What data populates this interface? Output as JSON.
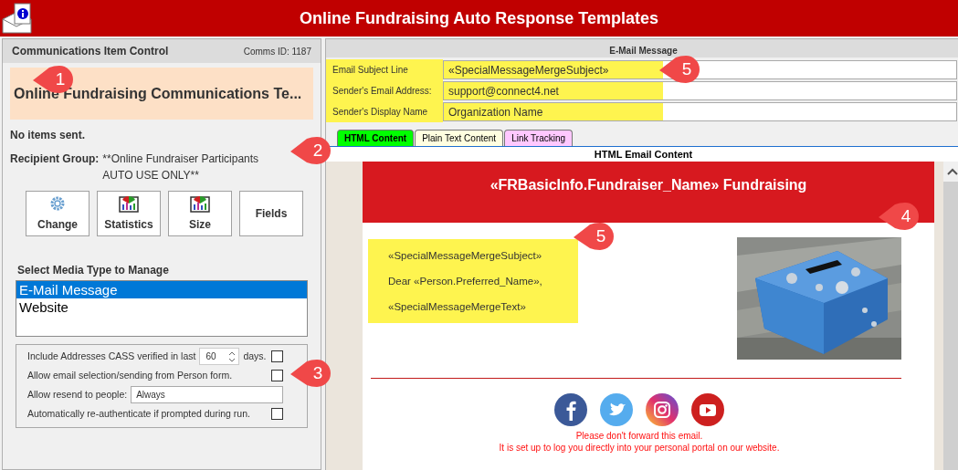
{
  "window": {
    "title": "Online Fundraising Auto Response Templates"
  },
  "left_panel": {
    "header": "Communications Item Control",
    "comms_id": "Comms ID: 1187",
    "item_title": "Online Fundraising Communications Te...",
    "sent_status": "No items sent.",
    "recipient_label": "Recipient Group:",
    "recipient_value": "**Online Fundraiser Participants AUTO USE ONLY**",
    "buttons": [
      {
        "label": "Change",
        "kind": "gear"
      },
      {
        "label": "Statistics",
        "kind": "chart"
      },
      {
        "label": "Size",
        "kind": "chart"
      },
      {
        "label": "Fields",
        "kind": "text"
      }
    ],
    "media_heading": "Select Media Type to Manage",
    "media_types": [
      {
        "label": "E-Mail Message",
        "selected": true
      },
      {
        "label": "Website",
        "selected": false
      }
    ],
    "options": [
      {
        "kind": "spin",
        "label": "Include Addresses CASS verified in last",
        "value": "60",
        "suffix": "days.",
        "checked": false
      },
      {
        "kind": "check",
        "label": "Allow email selection/sending from Person form.",
        "checked": false
      },
      {
        "kind": "select",
        "label": "Allow resend to people:",
        "value": "Always"
      },
      {
        "kind": "check",
        "label": "Automatically re-authenticate if prompted during run.",
        "checked": false
      }
    ]
  },
  "email_panel": {
    "header": "E-Mail Message",
    "fields": [
      {
        "label": "Email Subject Line",
        "value": "«SpecialMessageMergeSubject»",
        "highlighted": true
      },
      {
        "label": "Sender's Email Address:",
        "value": "support@connect4.net",
        "highlighted": true
      },
      {
        "label": "Sender's Display Name",
        "value": "Organization Name",
        "highlighted": true
      }
    ],
    "tabs": [
      {
        "label": "HTML Content",
        "selected": true,
        "color": "#00ff00"
      },
      {
        "label": "Plain Text Content",
        "selected": false,
        "color": "#ffffe0"
      },
      {
        "label": "Link Tracking",
        "selected": false,
        "color": "#ffc8ff"
      }
    ],
    "content_heading": "HTML Email Content",
    "preview": {
      "banner": "«FRBasicInfo.Fundraiser_Name» Fundraising",
      "body_highlighted": true,
      "body_lines": [
        "«SpecialMessageMergeSubject»",
        "Dear «Person.Preferred_Name»,",
        "«SpecialMessageMergeText»"
      ],
      "social": [
        {
          "kind": "facebook"
        },
        {
          "kind": "twitter"
        },
        {
          "kind": "instagram"
        },
        {
          "kind": "youtube"
        }
      ],
      "footer_lines": [
        "Please don't forward this email.",
        "It is set up to log you directly into your personal portal on our website."
      ]
    }
  },
  "callouts": [
    {
      "number": "1"
    },
    {
      "number": "2"
    },
    {
      "number": "3"
    },
    {
      "number": "4"
    },
    {
      "number": "5"
    },
    {
      "number": "5"
    }
  ]
}
